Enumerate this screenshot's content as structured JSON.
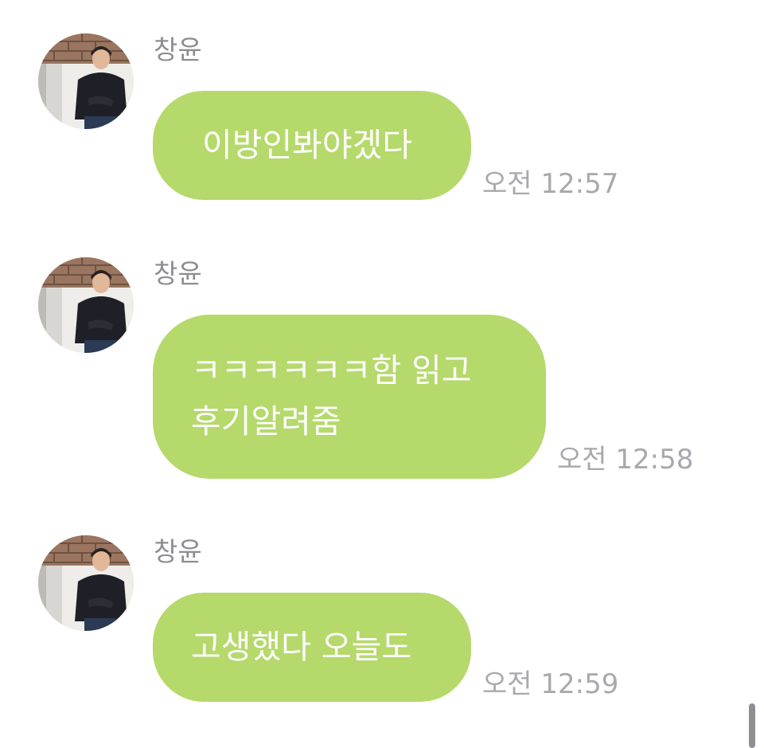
{
  "messages": [
    {
      "sender": "창윤",
      "text": "이방인봐야겠다",
      "time": "오전 12:57",
      "avatar_icon": "profile-photo-icon"
    },
    {
      "sender": "창윤",
      "text": "ㅋㅋㅋㅋㅋㅋ함 읽고\n후기알려줌",
      "time": "오전 12:58",
      "avatar_icon": "profile-photo-icon"
    },
    {
      "sender": "창윤",
      "text": "고생했다 오늘도",
      "time": "오전 12:59",
      "avatar_icon": "profile-photo-icon"
    }
  ],
  "colors": {
    "bubble": "#b5d96b",
    "bubble_text": "#ffffff",
    "sender": "#8d8d92",
    "time": "#a8a8ad"
  }
}
